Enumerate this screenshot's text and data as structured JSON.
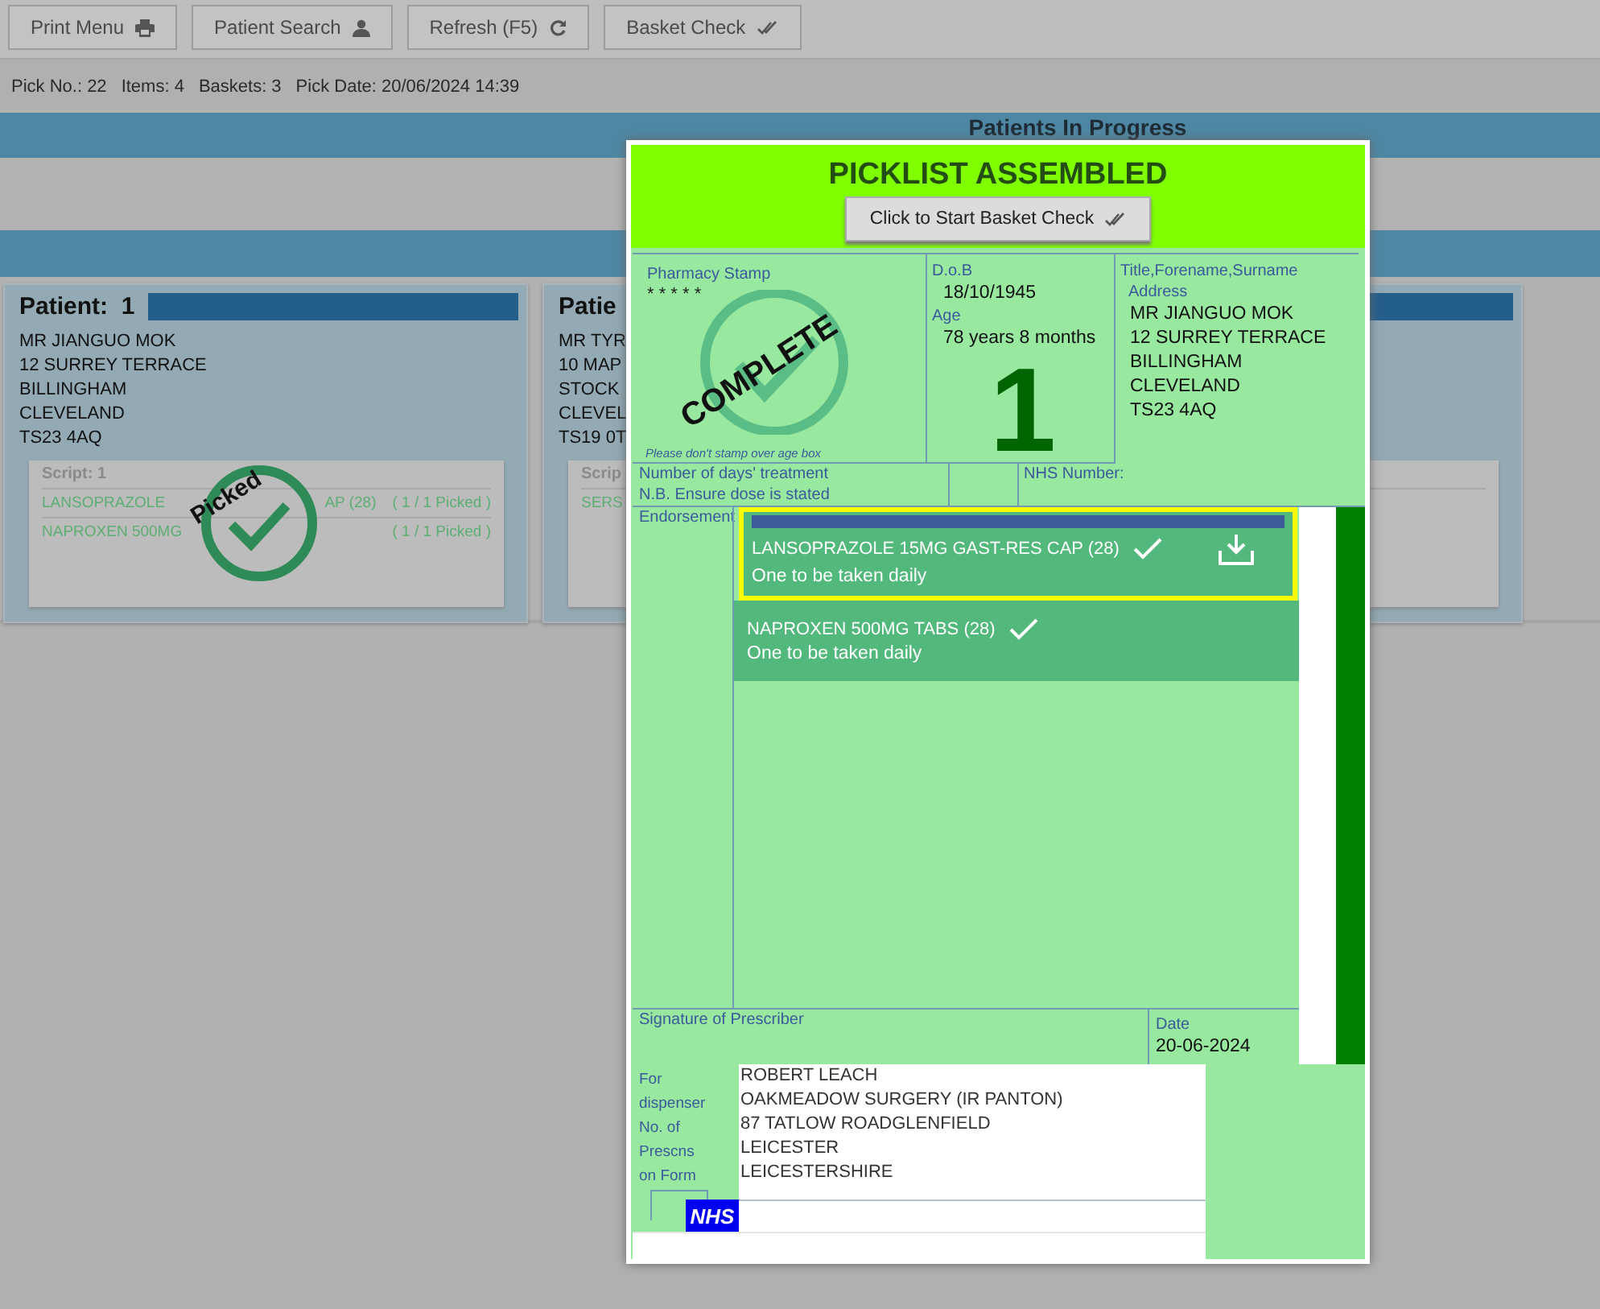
{
  "toolbar": {
    "buttons": [
      {
        "label": "Print Menu",
        "kind": "printer"
      },
      {
        "label": "Patient Search",
        "kind": "person"
      },
      {
        "label": "Refresh (F5)",
        "kind": "refresh"
      },
      {
        "label": "Basket Check",
        "kind": "check"
      }
    ]
  },
  "info_bar": {
    "fields": [
      "Pick No.: 22",
      "Items: 4",
      "Baskets: 3",
      "Pick Date: 20/06/2024 14:39"
    ]
  },
  "in_progress_heading": "Patients In Progress",
  "patients": [
    {
      "title": "Patient:  1",
      "lines": [
        "MR JIANGUO MOK",
        "12 SURREY TERRACE",
        "BILLINGHAM",
        "CLEVELAND",
        "TS23 4AQ"
      ],
      "script": {
        "label": "Script: 1",
        "items": [
          {
            "name": "LANSOPRAZOLE",
            "name_end": "AP (28)",
            "status": "( 1 / 1 Picked )"
          },
          {
            "name": "NAPROXEN 500MG",
            "status": "( 1 / 1 Picked )"
          }
        ]
      },
      "stamp": "Picked"
    },
    {
      "title": "Patie",
      "lines": [
        "MR TYR",
        "10 MAP",
        "STOCK",
        "CLEVEL",
        "TS19 0T"
      ],
      "script": {
        "label": "Scrip",
        "items": [
          {
            "name": "SERS"
          }
        ]
      }
    }
  ],
  "modal": {
    "title": "PICKLIST ASSEMBLED",
    "button": "Click to Start Basket Check",
    "stamp_label": "Pharmacy Stamp",
    "stamp_stars": "* * * * *",
    "stamp_text": "COMPLETE",
    "stamp_note": "Please don't stamp over age box",
    "dob_label": "D.o.B",
    "dob": "18/10/1945",
    "age_label": "Age",
    "age": "78 years 8 months",
    "basket_number": "1",
    "name_label": "Title,Forename,Surname",
    "address_label": "Address",
    "address": [
      "MR JIANGUO MOK",
      "12 SURREY TERRACE",
      "BILLINGHAM",
      "CLEVELAND",
      "TS23 4AQ"
    ],
    "days_label": "Number of days' treatment",
    "dose_note": "N.B. Ensure dose is stated",
    "nhs_number_label": "NHS Number:",
    "endorsement_label": "Endorsement",
    "items": [
      {
        "name": "LANSOPRAZOLE 15MG GAST-RES CAP (28)",
        "dosage": "One to be taken daily",
        "checked": true,
        "selected": true
      },
      {
        "name": "NAPROXEN 500MG TABS (28)",
        "dosage": "One to be taken daily",
        "checked": true,
        "selected": false
      }
    ],
    "signature_label": "Signature of Prescriber",
    "date_label": "Date",
    "date": "20-06-2024",
    "dispenser_label": [
      "For",
      "dispenser",
      "No. of",
      "Prescns",
      "on Form"
    ],
    "prescriber": [
      "ROBERT LEACH",
      "OAKMEADOW SURGERY (IR PANTON)",
      "87 TATLOW ROADGLENFIELD",
      "LEICESTER",
      "LEICESTERSHIRE"
    ],
    "nhs_logo": "NHS"
  }
}
